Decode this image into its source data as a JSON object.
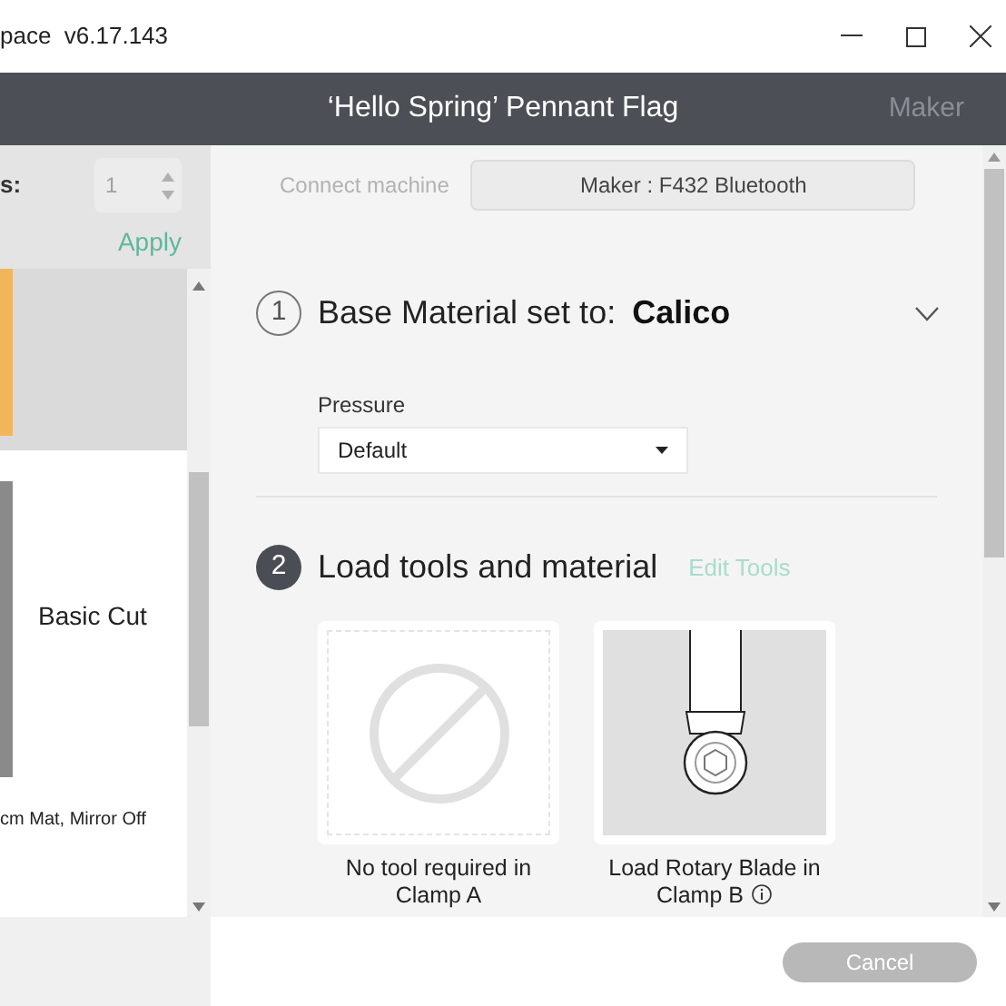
{
  "window": {
    "title": "pace  v6.17.143"
  },
  "header": {
    "title": "‘Hello Spring’ Pennant Flag",
    "machine": "Maker"
  },
  "left_panel": {
    "copies_label": "s:",
    "copies_value": "1",
    "apply": "Apply",
    "mats": [
      {
        "selected": true,
        "color": "#f2b65a"
      },
      {
        "label": "Basic Cut",
        "selected": false,
        "color": "#8a8a8a",
        "caption": "cm Mat, Mirror Off"
      }
    ]
  },
  "main": {
    "connect_label": "Connect machine",
    "machine_button": "Maker : F432 Bluetooth",
    "steps": [
      {
        "number": "1",
        "title": "Base Material set to:",
        "value": "Calico",
        "active": false
      },
      {
        "number": "2",
        "title": "Load tools and material",
        "link": "Edit Tools",
        "active": true
      }
    ],
    "pressure": {
      "label": "Pressure",
      "value": "Default"
    },
    "tools": [
      {
        "kind": "none",
        "caption": "No tool required in Clamp A",
        "info": false
      },
      {
        "kind": "rotary_blade",
        "caption": "Load Rotary Blade in Clamp B",
        "info": true
      }
    ]
  },
  "footer": {
    "cancel": {
      "label": "Cancel",
      "disabled": true
    }
  }
}
